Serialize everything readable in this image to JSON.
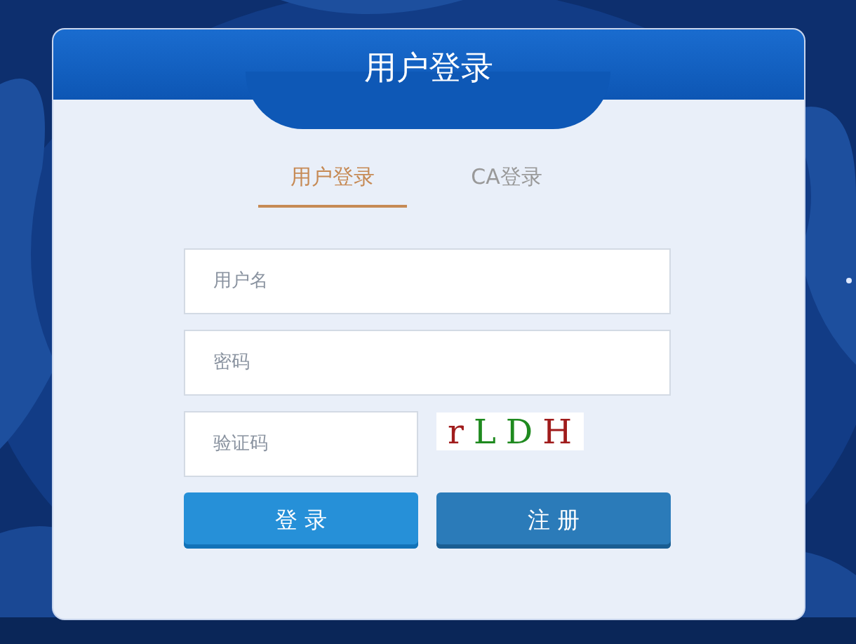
{
  "header": {
    "title": "用户登录"
  },
  "tabs": [
    {
      "label": "用户登录",
      "selected": true
    },
    {
      "label": "CA登录",
      "selected": false
    }
  ],
  "fields": [
    {
      "placeholder": "用户名"
    },
    {
      "placeholder": "密码"
    }
  ],
  "captcha": {
    "placeholder": "验证码",
    "letters": [
      {
        "char": "r",
        "color": "#a01c1c"
      },
      {
        "char": "L",
        "color": "#1f8a1f"
      },
      {
        "char": "D",
        "color": "#1f8a1f"
      },
      {
        "char": "H",
        "color": "#a01c1c"
      }
    ]
  },
  "buttons": [
    {
      "label": "登 录",
      "kind": "primary"
    },
    {
      "label": "注 册",
      "kind": "secondary"
    }
  ]
}
